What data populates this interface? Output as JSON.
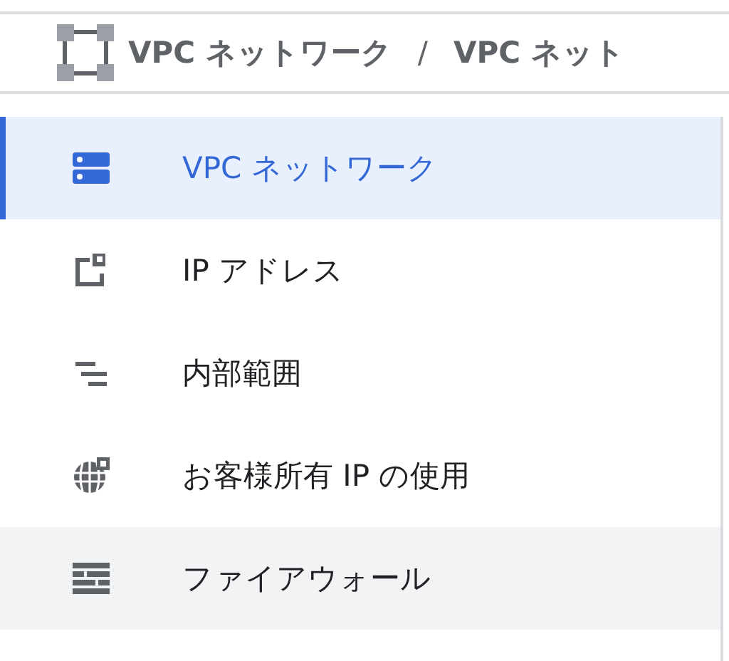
{
  "breadcrumb": {
    "items": [
      "VPC ネットワーク",
      "VPC ネット"
    ],
    "separator": "/"
  },
  "nav": {
    "items": [
      {
        "label": "VPC ネットワーク",
        "selected": true,
        "hovered": false
      },
      {
        "label": "IP アドレス",
        "selected": false,
        "hovered": false
      },
      {
        "label": "内部範囲",
        "selected": false,
        "hovered": false
      },
      {
        "label": "お客様所有 IP の使用",
        "selected": false,
        "hovered": false
      },
      {
        "label": "ファイアウォール",
        "selected": false,
        "hovered": true
      }
    ]
  }
}
